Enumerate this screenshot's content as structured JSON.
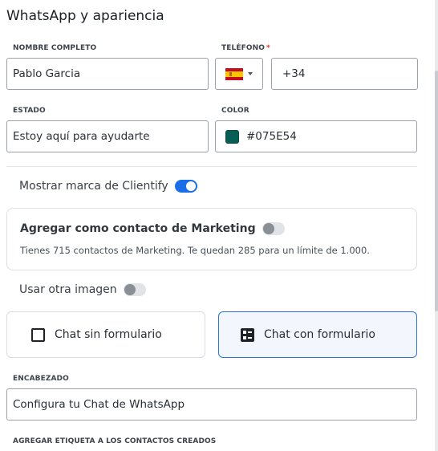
{
  "title": "WhatsApp y apariencia",
  "fields": {
    "nombre": {
      "label": "NOMBRE COMPLETO",
      "value": "Pablo Garcia"
    },
    "telefono": {
      "label": "TELÉFONO",
      "required_mark": "*",
      "country": "ES",
      "prefix": "+34"
    },
    "estado": {
      "label": "ESTADO",
      "value": "Estoy aquí para ayudarte"
    },
    "color": {
      "label": "COLOR",
      "value": "#075E54",
      "swatch": "#075E54"
    },
    "encabezado": {
      "label": "ENCABEZADO",
      "value": "Configura tu Chat de WhatsApp"
    },
    "etiqueta": {
      "label": "AGREGAR ETIQUETA A LOS CONTACTOS CREADOS"
    }
  },
  "toggles": {
    "mostrar_marca": {
      "label": "Mostrar marca de Clientify",
      "on": true
    },
    "contacto_marketing": {
      "label": "Agregar como contacto de Marketing",
      "on": false
    },
    "otra_imagen": {
      "label": "Usar otra imagen",
      "on": false
    }
  },
  "marketing_note": "Tienes 715 contactos de Marketing. Te quedan 285 para un límite de 1.000.",
  "chat_options": {
    "sin_formulario": {
      "label": "Chat sin formulario",
      "icon": "checkbox-empty-icon",
      "selected": false
    },
    "con_formulario": {
      "label": "Chat con formulario",
      "icon": "form-list-icon",
      "selected": true
    }
  },
  "colors": {
    "accent": "#1a6fe8",
    "required": "#e0342f",
    "brand_green": "#075E54"
  }
}
